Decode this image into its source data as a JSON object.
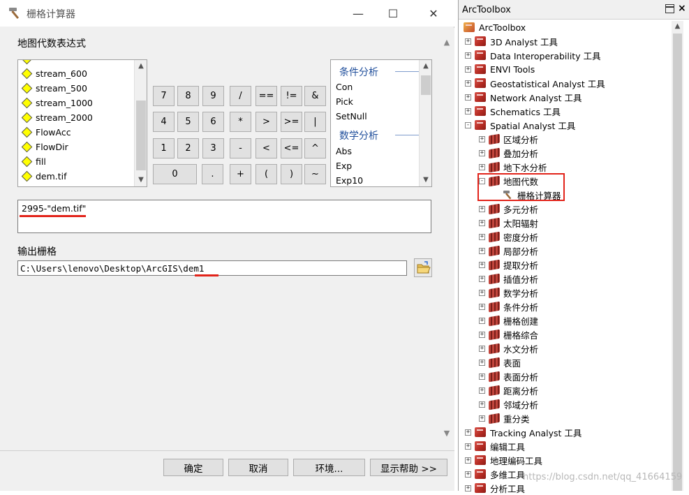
{
  "dialog": {
    "title": "栅格计算器",
    "expression_label": "地图代数表达式",
    "layers": [
      "stream_600",
      "stream_500",
      "stream_1000",
      "stream_2000",
      "FlowAcc",
      "FlowDir",
      "fill",
      "dem.tif"
    ],
    "keypad": [
      [
        "7",
        "8",
        "9",
        "/",
        "==",
        "!=",
        "&"
      ],
      [
        "4",
        "5",
        "6",
        "*",
        ">",
        ">=",
        "|"
      ],
      [
        "1",
        "2",
        "3",
        "-",
        "<",
        "<=",
        "^"
      ],
      [
        "0",
        ".",
        "+",
        "(",
        ")",
        "~"
      ]
    ],
    "functions": {
      "group1": "条件分析",
      "group1_items": [
        "Con",
        "Pick",
        "SetNull"
      ],
      "group2": "数学分析",
      "group2_items": [
        "Abs",
        "Exp",
        "Exp10"
      ]
    },
    "expression": "2995-\"dem.tif\"",
    "output_label": "输出栅格",
    "output_path": "C:\\Users\\lenovo\\Desktop\\ArcGIS\\dem1",
    "buttons": {
      "ok": "确定",
      "cancel": "取消",
      "env": "环境...",
      "help": "显示帮助 >>"
    }
  },
  "toolbox": {
    "title": "ArcToolbox",
    "root": "ArcToolbox",
    "top_before": [
      "3D Analyst 工具",
      "Data Interoperability 工具",
      "ENVI Tools",
      "Geostatistical Analyst 工具",
      "Network Analyst 工具",
      "Schematics 工具"
    ],
    "spatial": "Spatial Analyst 工具",
    "spatial_before": [
      "区域分析",
      "叠加分析",
      "地下水分析"
    ],
    "map_algebra": "地图代数",
    "raster_calc": "栅格计算器",
    "spatial_after": [
      "多元分析",
      "太阳辐射",
      "密度分析",
      "局部分析",
      "提取分析",
      "插值分析",
      "数学分析",
      "条件分析",
      "栅格创建",
      "栅格综合",
      "水文分析",
      "表面",
      "表面分析",
      "距离分析",
      "邻域分析",
      "重分类"
    ],
    "top_after": [
      "Tracking Analyst 工具",
      "编辑工具",
      "地理编码工具",
      "多维工具",
      "分析工具"
    ],
    "watermark": "https://blog.csdn.net/qq_41664159"
  },
  "colors": {
    "highlight": "#e2231a",
    "func_head": "#1f4e9b"
  }
}
